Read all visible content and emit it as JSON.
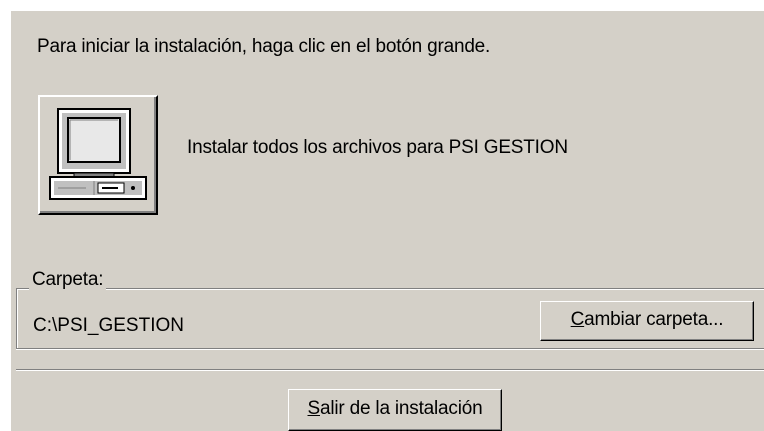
{
  "dialog": {
    "instruction": "Para iniciar la instalación, haga clic en el botón grande.",
    "install_label": "Instalar todos los archivos para  PSI GESTION",
    "install_icon": "computer-icon"
  },
  "folder": {
    "legend": "Carpeta:",
    "path": "C:\\PSI_GESTION",
    "change_button": {
      "mnemonic": "C",
      "rest": "ambiar carpeta..."
    }
  },
  "exit_button": {
    "mnemonic": "S",
    "rest": "alir de la instalación"
  }
}
